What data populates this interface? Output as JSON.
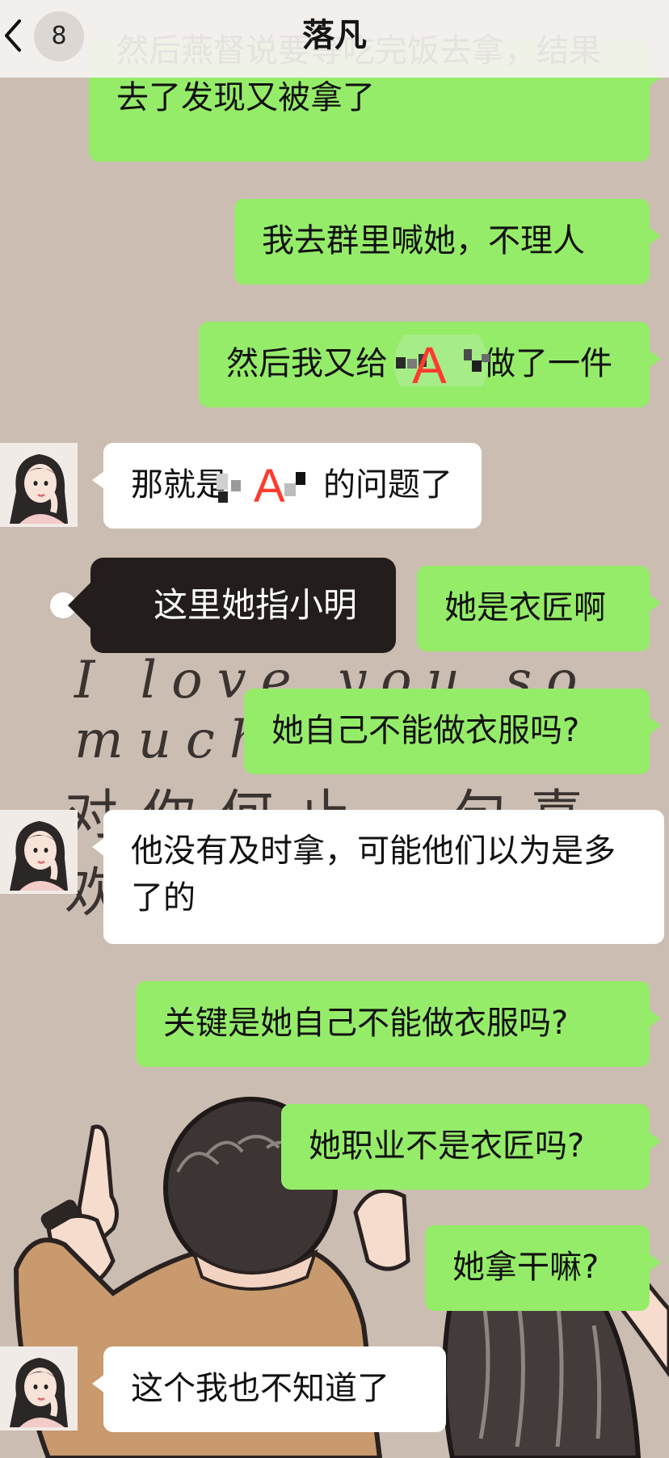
{
  "header": {
    "title": "落凡",
    "unread_count": "8"
  },
  "background_text": {
    "line1": "I love you so much",
    "line2": "对你何止一句喜欢"
  },
  "messages": [
    {
      "side": "out",
      "text": "然后燕督说要等吃完饭去拿，结果去了发现又被拿了"
    },
    {
      "side": "out",
      "text": "我去群里喊她，不理人"
    },
    {
      "side": "out",
      "text_before": "然后我又给",
      "mark": "A",
      "text_after": "做了一件"
    },
    {
      "side": "in",
      "text_before": "那就是",
      "mark": "A",
      "text_after": "的问题了"
    },
    {
      "side": "out",
      "text": "她是衣匠啊"
    },
    {
      "side": "out",
      "text": "她自己不能做衣服吗?"
    },
    {
      "side": "in",
      "text": "他没有及时拿，可能他们以为是多了的"
    },
    {
      "side": "out",
      "text": "关键是她自己不能做衣服吗?"
    },
    {
      "side": "out",
      "text": "她职业不是衣匠吗?"
    },
    {
      "side": "out",
      "text": "她拿干嘛?"
    },
    {
      "side": "in",
      "text": "这个我也不知道了"
    }
  ],
  "annotation": {
    "text": "这里她指小明"
  },
  "colors": {
    "outgoing_bubble": "#95ec69",
    "incoming_bubble": "#ffffff",
    "annotation_bg": "#231d1b",
    "mark": "#ff3b2f"
  }
}
